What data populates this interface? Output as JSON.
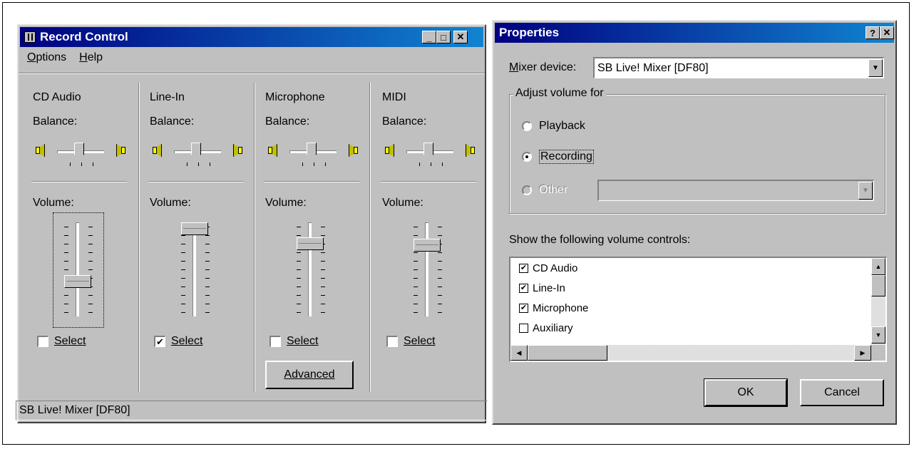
{
  "record_control": {
    "title": "Record Control",
    "menu": [
      "Options",
      "Help"
    ],
    "columns": [
      {
        "title": "CD Audio",
        "balance_label": "Balance:",
        "volume_label": "Volume:",
        "select_label": "Select",
        "selected": false,
        "volume_level": 0.35
      },
      {
        "title": "Line-In",
        "balance_label": "Balance:",
        "volume_label": "Volume:",
        "select_label": "Select",
        "selected": true,
        "volume_level": 1.0
      },
      {
        "title": "Microphone",
        "balance_label": "Balance:",
        "volume_label": "Volume:",
        "select_label": "Select",
        "selected": false,
        "volume_level": 0.82
      },
      {
        "title": "MIDI",
        "balance_label": "Balance:",
        "volume_label": "Volume:",
        "select_label": "Select",
        "selected": false,
        "volume_level": 0.8
      }
    ],
    "advanced_label": "Advanced",
    "status": "SB Live! Mixer [DF80]"
  },
  "properties": {
    "title": "Properties",
    "mixer_device_label": "Mixer device:",
    "mixer_device_value": "SB Live! Mixer [DF80]",
    "adjust_group_label": "Adjust volume for",
    "radios": [
      {
        "label": "Playback",
        "checked": false,
        "enabled": true
      },
      {
        "label": "Recording",
        "checked": true,
        "enabled": true
      },
      {
        "label": "Other",
        "checked": false,
        "enabled": false
      }
    ],
    "show_controls_label": "Show the following volume controls:",
    "controls": [
      {
        "label": "CD Audio",
        "checked": true
      },
      {
        "label": "Line-In",
        "checked": true
      },
      {
        "label": "Microphone",
        "checked": true
      },
      {
        "label": "Auxiliary",
        "checked": false
      }
    ],
    "ok_label": "OK",
    "cancel_label": "Cancel"
  }
}
